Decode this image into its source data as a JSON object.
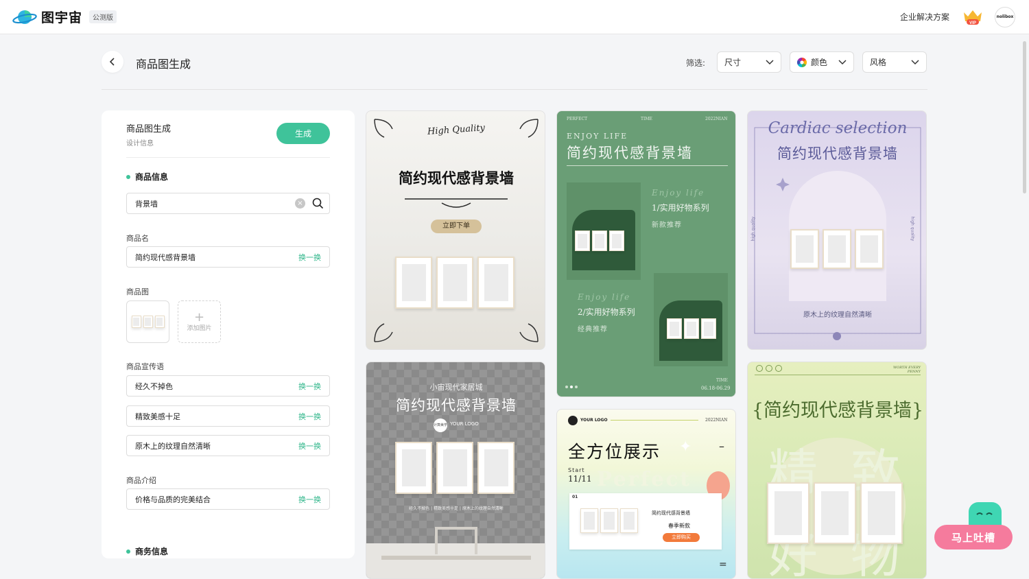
{
  "header": {
    "brand": "图宇宙",
    "beta_tag": "公测版",
    "enterprise_link": "企业解决方案",
    "vip_label": "VIP",
    "avatar_text": "nolibox"
  },
  "toolbar": {
    "title": "商品图生成",
    "filter_label": "筛选:",
    "size_select": "尺寸",
    "color_select": "颜色",
    "style_select": "风格"
  },
  "panel": {
    "title": "商品图生成",
    "subtitle": "设计信息",
    "generate_label": "生成",
    "product_info_heading": "商品信息",
    "search_value": "背景墙",
    "product_name_label": "商品名",
    "product_name_value": "简约现代感背景墙",
    "swap_label": "换一换",
    "product_image_label": "商品图",
    "add_image_label": "添加图片",
    "slogan_label": "商品宣传语",
    "slogans": [
      "经久不掉色",
      "精致美感十足",
      "原木上的纹理自然清晰"
    ],
    "intro_label": "商品介绍",
    "intro_value": "价格与品质的完美结合",
    "business_heading": "商务信息"
  },
  "cards": {
    "c1": {
      "script": "High Quality",
      "title": "简约现代感背景墙",
      "cta": "立即下单"
    },
    "c2": {
      "top_left": "PERFECT",
      "top_mid": "TIME",
      "top_right": "2022NIAN",
      "en": "ENJOY LIFE",
      "title": "简约现代感背景墙",
      "script1": "Enjoy life",
      "series1": "1/实用好物系列",
      "sub1": "新款推荐",
      "script2": "Enjoy life",
      "series2": "2/实用好物系列",
      "sub2": "经典推荐",
      "time_label": "TIME",
      "date": "06.18-06.29"
    },
    "c3": {
      "script": "Cardiac selection",
      "title": "简约现代感背景墙",
      "side": "high quality",
      "caption": "原木上的纹理自然清晰"
    },
    "c4": {
      "subtitle": "小宙现代家居城",
      "title": "简约现代感背景墙",
      "logo_text": "YOUR LOGO",
      "logo_badge": "计算美学",
      "tagline": "经久不掉色 | 精致美感十足 | 原木上的纹理自然清晰"
    },
    "c5": {
      "logo": "YOUR LOGO",
      "year": "2022NIAN",
      "headline": "全方位展示",
      "start": "Start",
      "date": "11/11",
      "bg_word": "Perfect",
      "num": "01",
      "product": "简约现代感背景墙",
      "season": "春季新款",
      "cta": "立即购买"
    },
    "c6": {
      "top_right": "WORTH EVERY PENNY",
      "title": "{简约现代感背景墙}",
      "bg1": "精",
      "bg2": "致",
      "bg3": "好",
      "bg4": "物"
    }
  },
  "widget": {
    "label": "马上吐槽"
  },
  "colors": {
    "accent": "#3fc39a",
    "feedback": "#f57b9d"
  }
}
